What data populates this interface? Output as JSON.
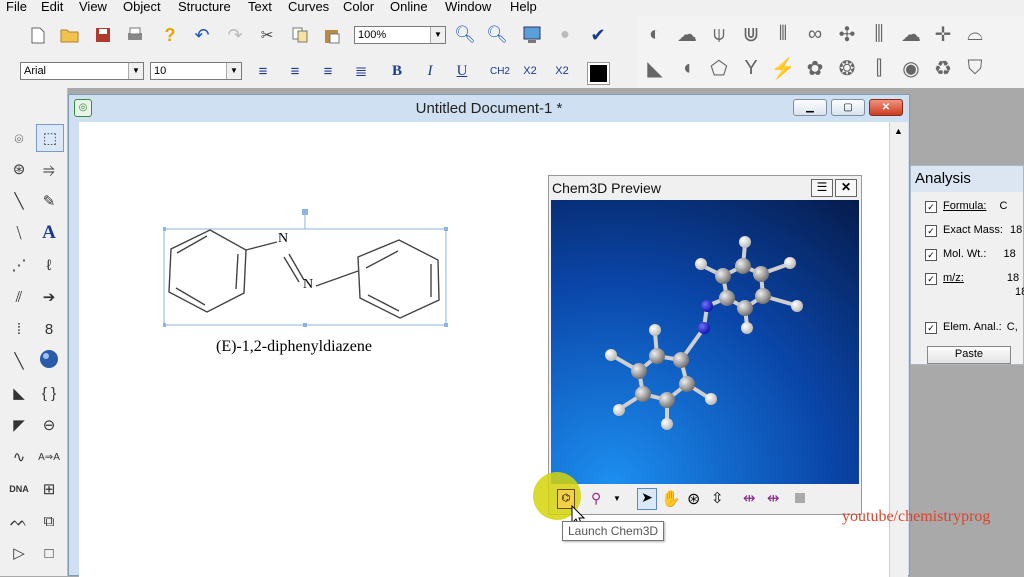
{
  "menu": [
    "File",
    "Edit",
    "View",
    "Object",
    "Structure",
    "Text",
    "Curves",
    "Color",
    "Online",
    "Window",
    "Help"
  ],
  "toolbar": {
    "zoom_value": "100%",
    "font_name": "Arial",
    "font_size": "10",
    "bold": "B",
    "italic": "I",
    "underline": "U",
    "formula": "CH2",
    "subscript": "X2",
    "superscript": "X2",
    "text_tool": "A"
  },
  "document": {
    "title": "Untitled Document-1 *",
    "caption": "(E)-1,2-diphenyldiazene",
    "atom_n": "N"
  },
  "preview": {
    "title": "Chem3D Preview",
    "tooltip": "Launch Chem3D"
  },
  "analysis": {
    "title": "Analysis",
    "rows": [
      {
        "label": "Formula:",
        "value": "C"
      },
      {
        "label": "Exact Mass:",
        "value": "18"
      },
      {
        "label": "Mol. Wt.:",
        "value": "18"
      },
      {
        "label": "m/z:",
        "value": "18"
      },
      {
        "label": "",
        "value": "18"
      },
      {
        "label": "Elem. Anal.:",
        "value": "C,"
      }
    ],
    "paste_label": "Paste"
  },
  "watermark": "youtube/chemistryprog",
  "colors": {
    "accent_blue": "#0a5cc2",
    "close_red": "#d8452d",
    "highlight": "#d4d40a"
  }
}
